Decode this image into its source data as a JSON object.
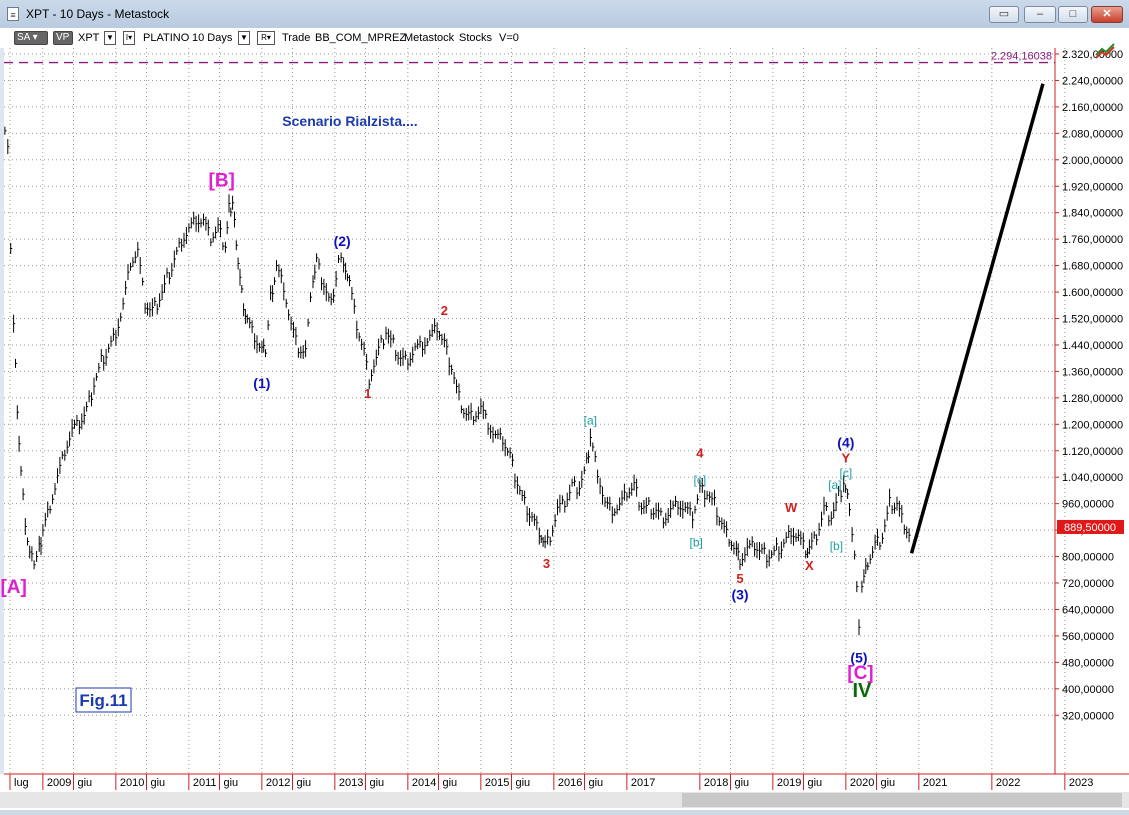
{
  "window": {
    "title": "XPT - 10 Days - Metastock",
    "app_icon": "document-icon",
    "buttons": [
      "restore-icon",
      "minimize-icon",
      "maximize-icon",
      "close-icon"
    ]
  },
  "toolbar": {
    "sa_label": "SA",
    "vp_label": "VP",
    "symbol": "XPT",
    "name": "PLATINO",
    "period": "10 Days",
    "r_label": "R",
    "trade": "Trade",
    "layout": "BB_COM_MPREZ",
    "source": "Metastock",
    "type": "Stocks",
    "v": "V=0"
  },
  "chart_data": {
    "type": "line",
    "scenario_title": "Scenario Rialzista....",
    "figure_label": "Fig.11",
    "price_axis": {
      "ticks": [
        "2.320,00000",
        "2.240,00000",
        "2.160,00000",
        "2.080,00000",
        "2.000,00000",
        "1.920,00000",
        "1.840,00000",
        "1.760,00000",
        "1.680,00000",
        "1.600,00000",
        "1.520,00000",
        "1.440,00000",
        "1.360,00000",
        "1.280,00000",
        "1.200,00000",
        "1.120,00000",
        "1.040,00000",
        "960,00000",
        "880,00000",
        "800,00000",
        "720,00000",
        "640,00000",
        "560,00000",
        "480,00000",
        "400,00000",
        "320,00000"
      ],
      "tick_values": [
        2320,
        2240,
        2160,
        2080,
        2000,
        1920,
        1840,
        1760,
        1680,
        1600,
        1520,
        1440,
        1360,
        1280,
        1200,
        1120,
        1040,
        960,
        880,
        800,
        720,
        640,
        560,
        480,
        400,
        320
      ],
      "ylim": [
        250,
        2390
      ]
    },
    "time_axis": {
      "labels": [
        {
          "text": "lug",
          "t": 2008.55
        },
        {
          "text": "2009",
          "t": 2009.0
        },
        {
          "text": "giu",
          "t": 2009.42
        },
        {
          "text": "2010",
          "t": 2010.0
        },
        {
          "text": "giu",
          "t": 2010.42
        },
        {
          "text": "2011",
          "t": 2011.0
        },
        {
          "text": "giu",
          "t": 2011.42
        },
        {
          "text": "2012",
          "t": 2012.0
        },
        {
          "text": "giu",
          "t": 2012.42
        },
        {
          "text": "2013",
          "t": 2013.0
        },
        {
          "text": "giu",
          "t": 2013.42
        },
        {
          "text": "2014",
          "t": 2014.0
        },
        {
          "text": "giu",
          "t": 2014.42
        },
        {
          "text": "2015",
          "t": 2015.0
        },
        {
          "text": "giu",
          "t": 2015.42
        },
        {
          "text": "2016",
          "t": 2016.0
        },
        {
          "text": "giu",
          "t": 2016.42
        },
        {
          "text": "2017",
          "t": 2017.0
        },
        {
          "text": "2018",
          "t": 2018.0
        },
        {
          "text": "giu",
          "t": 2018.42
        },
        {
          "text": "2019",
          "t": 2019.0
        },
        {
          "text": "giu",
          "t": 2019.42
        },
        {
          "text": "2020",
          "t": 2020.0
        },
        {
          "text": "giu",
          "t": 2020.42
        },
        {
          "text": "2021",
          "t": 2021.0
        },
        {
          "text": "2022",
          "t": 2022.0
        },
        {
          "text": "2023",
          "t": 2023.0
        }
      ],
      "xlim": [
        2008.45,
        2023.45
      ]
    },
    "resistance_line": {
      "value": 2294.16038,
      "label": "2.294,16038"
    },
    "last_price": {
      "value": 889.5,
      "label": "889,50000"
    },
    "price_path": [
      [
        2008.48,
        2070
      ],
      [
        2008.52,
        2040
      ],
      [
        2008.56,
        1750
      ],
      [
        2008.6,
        1500
      ],
      [
        2008.65,
        1250
      ],
      [
        2008.7,
        1050
      ],
      [
        2008.76,
        900
      ],
      [
        2008.82,
        800
      ],
      [
        2008.88,
        780
      ],
      [
        2008.95,
        820
      ],
      [
        2009.0,
        880
      ],
      [
        2009.1,
        960
      ],
      [
        2009.2,
        1040
      ],
      [
        2009.3,
        1120
      ],
      [
        2009.4,
        1180
      ],
      [
        2009.5,
        1200
      ],
      [
        2009.6,
        1240
      ],
      [
        2009.7,
        1320
      ],
      [
        2009.8,
        1390
      ],
      [
        2009.9,
        1430
      ],
      [
        2010.0,
        1480
      ],
      [
        2010.1,
        1560
      ],
      [
        2010.2,
        1690
      ],
      [
        2010.3,
        1720
      ],
      [
        2010.4,
        1560
      ],
      [
        2010.5,
        1540
      ],
      [
        2010.6,
        1580
      ],
      [
        2010.7,
        1640
      ],
      [
        2010.8,
        1700
      ],
      [
        2010.9,
        1760
      ],
      [
        2011.0,
        1790
      ],
      [
        2011.1,
        1820
      ],
      [
        2011.2,
        1810
      ],
      [
        2011.3,
        1760
      ],
      [
        2011.4,
        1790
      ],
      [
        2011.5,
        1740
      ],
      [
        2011.55,
        1850
      ],
      [
        2011.6,
        1870
      ],
      [
        2011.65,
        1760
      ],
      [
        2011.7,
        1640
      ],
      [
        2011.75,
        1560
      ],
      [
        2011.8,
        1510
      ],
      [
        2011.9,
        1460
      ],
      [
        2012.0,
        1420
      ],
      [
        2012.05,
        1420
      ],
      [
        2012.12,
        1580
      ],
      [
        2012.2,
        1680
      ],
      [
        2012.3,
        1620
      ],
      [
        2012.4,
        1500
      ],
      [
        2012.5,
        1430
      ],
      [
        2012.6,
        1420
      ],
      [
        2012.7,
        1640
      ],
      [
        2012.75,
        1690
      ],
      [
        2012.85,
        1620
      ],
      [
        2012.95,
        1560
      ],
      [
        2013.05,
        1700
      ],
      [
        2013.12,
        1700
      ],
      [
        2013.2,
        1630
      ],
      [
        2013.3,
        1500
      ],
      [
        2013.4,
        1420
      ],
      [
        2013.47,
        1330
      ],
      [
        2013.6,
        1420
      ],
      [
        2013.7,
        1480
      ],
      [
        2013.8,
        1440
      ],
      [
        2013.9,
        1400
      ],
      [
        2014.0,
        1400
      ],
      [
        2014.1,
        1430
      ],
      [
        2014.2,
        1440
      ],
      [
        2014.3,
        1460
      ],
      [
        2014.4,
        1490
      ],
      [
        2014.5,
        1440
      ],
      [
        2014.6,
        1370
      ],
      [
        2014.7,
        1280
      ],
      [
        2014.8,
        1230
      ],
      [
        2014.9,
        1230
      ],
      [
        2015.0,
        1250
      ],
      [
        2015.1,
        1200
      ],
      [
        2015.2,
        1160
      ],
      [
        2015.3,
        1150
      ],
      [
        2015.4,
        1100
      ],
      [
        2015.5,
        1020
      ],
      [
        2015.6,
        960
      ],
      [
        2015.7,
        920
      ],
      [
        2015.8,
        880
      ],
      [
        2015.88,
        840
      ],
      [
        2015.95,
        860
      ],
      [
        2016.05,
        940
      ],
      [
        2016.15,
        960
      ],
      [
        2016.25,
        1010
      ],
      [
        2016.35,
        1010
      ],
      [
        2016.45,
        1080
      ],
      [
        2016.5,
        1160
      ],
      [
        2016.6,
        1060
      ],
      [
        2016.7,
        960
      ],
      [
        2016.8,
        940
      ],
      [
        2016.9,
        950
      ],
      [
        2017.0,
        990
      ],
      [
        2017.1,
        1010
      ],
      [
        2017.2,
        950
      ],
      [
        2017.3,
        950
      ],
      [
        2017.4,
        940
      ],
      [
        2017.5,
        920
      ],
      [
        2017.6,
        940
      ],
      [
        2017.7,
        960
      ],
      [
        2017.8,
        940
      ],
      [
        2017.9,
        920
      ],
      [
        2018.0,
        1000
      ],
      [
        2018.1,
        990
      ],
      [
        2018.2,
        960
      ],
      [
        2018.3,
        900
      ],
      [
        2018.4,
        860
      ],
      [
        2018.5,
        820
      ],
      [
        2018.55,
        790
      ],
      [
        2018.65,
        820
      ],
      [
        2018.75,
        830
      ],
      [
        2018.85,
        810
      ],
      [
        2018.95,
        800
      ],
      [
        2019.05,
        820
      ],
      [
        2019.15,
        840
      ],
      [
        2019.25,
        880
      ],
      [
        2019.35,
        860
      ],
      [
        2019.45,
        820
      ],
      [
        2019.5,
        820
      ],
      [
        2019.6,
        860
      ],
      [
        2019.7,
        940
      ],
      [
        2019.8,
        920
      ],
      [
        2019.9,
        980
      ],
      [
        2019.97,
        1020
      ],
      [
        2020.05,
        960
      ],
      [
        2020.12,
        800
      ],
      [
        2020.18,
        600
      ],
      [
        2020.22,
        700
      ],
      [
        2020.3,
        780
      ],
      [
        2020.4,
        830
      ],
      [
        2020.5,
        860
      ],
      [
        2020.6,
        960
      ],
      [
        2020.7,
        960
      ],
      [
        2020.8,
        900
      ],
      [
        2020.9,
        860
      ]
    ],
    "projection_line": [
      [
        2020.9,
        810
      ],
      [
        2022.7,
        2230
      ]
    ],
    "wave_labels": [
      {
        "text": "[A]",
        "t": 2008.6,
        "y": 690,
        "color": "#e020d0",
        "kind": "bracket"
      },
      {
        "text": "[B]",
        "t": 2011.45,
        "y": 1920,
        "color": "#e020d0",
        "kind": "bracket"
      },
      {
        "text": "(1)",
        "t": 2012.0,
        "y": 1310,
        "color": "#1010c0",
        "kind": "paren"
      },
      {
        "text": "(2)",
        "t": 2013.1,
        "y": 1740,
        "color": "#1010c0",
        "kind": "paren"
      },
      {
        "text": "1",
        "t": 2013.45,
        "y": 1280,
        "color": "#d02020",
        "kind": "num"
      },
      {
        "text": "2",
        "t": 2014.5,
        "y": 1530,
        "color": "#d02020",
        "kind": "num"
      },
      {
        "text": "3",
        "t": 2015.9,
        "y": 765,
        "color": "#d02020",
        "kind": "num"
      },
      {
        "text": "[a]",
        "t": 2016.5,
        "y": 1200,
        "color": "#20a0a0",
        "kind": "small"
      },
      {
        "text": "4",
        "t": 2018.0,
        "y": 1100,
        "color": "#d02020",
        "kind": "num"
      },
      {
        "text": "[c]",
        "t": 2018.0,
        "y": 1020,
        "color": "#20a0a0",
        "kind": "small"
      },
      {
        "text": "[b]",
        "t": 2017.95,
        "y": 830,
        "color": "#20a0a0",
        "kind": "small"
      },
      {
        "text": "5",
        "t": 2018.55,
        "y": 720,
        "color": "#d02020",
        "kind": "num"
      },
      {
        "text": "(3)",
        "t": 2018.55,
        "y": 670,
        "color": "#1010c0",
        "kind": "paren"
      },
      {
        "text": "W",
        "t": 2019.25,
        "y": 935,
        "color": "#d02020",
        "kind": "num"
      },
      {
        "text": "X",
        "t": 2019.5,
        "y": 760,
        "color": "#d02020",
        "kind": "num"
      },
      {
        "text": "[a]",
        "t": 2019.85,
        "y": 1005,
        "color": "#20a0a0",
        "kind": "small"
      },
      {
        "text": "[b]",
        "t": 2019.87,
        "y": 820,
        "color": "#20a0a0",
        "kind": "small"
      },
      {
        "text": "(4)",
        "t": 2020.0,
        "y": 1130,
        "color": "#1010c0",
        "kind": "paren"
      },
      {
        "text": "Y",
        "t": 2020.0,
        "y": 1085,
        "color": "#d02020",
        "kind": "num"
      },
      {
        "text": "[c]",
        "t": 2020.0,
        "y": 1040,
        "color": "#20a0a0",
        "kind": "small"
      },
      {
        "text": "(5)",
        "t": 2020.18,
        "y": 480,
        "color": "#1010c0",
        "kind": "paren"
      },
      {
        "text": "[C]",
        "t": 2020.2,
        "y": 430,
        "color": "#e020d0",
        "kind": "bracket"
      },
      {
        "text": "IV",
        "t": 2020.22,
        "y": 375,
        "color": "#0a6a0a",
        "kind": "roman"
      }
    ]
  }
}
